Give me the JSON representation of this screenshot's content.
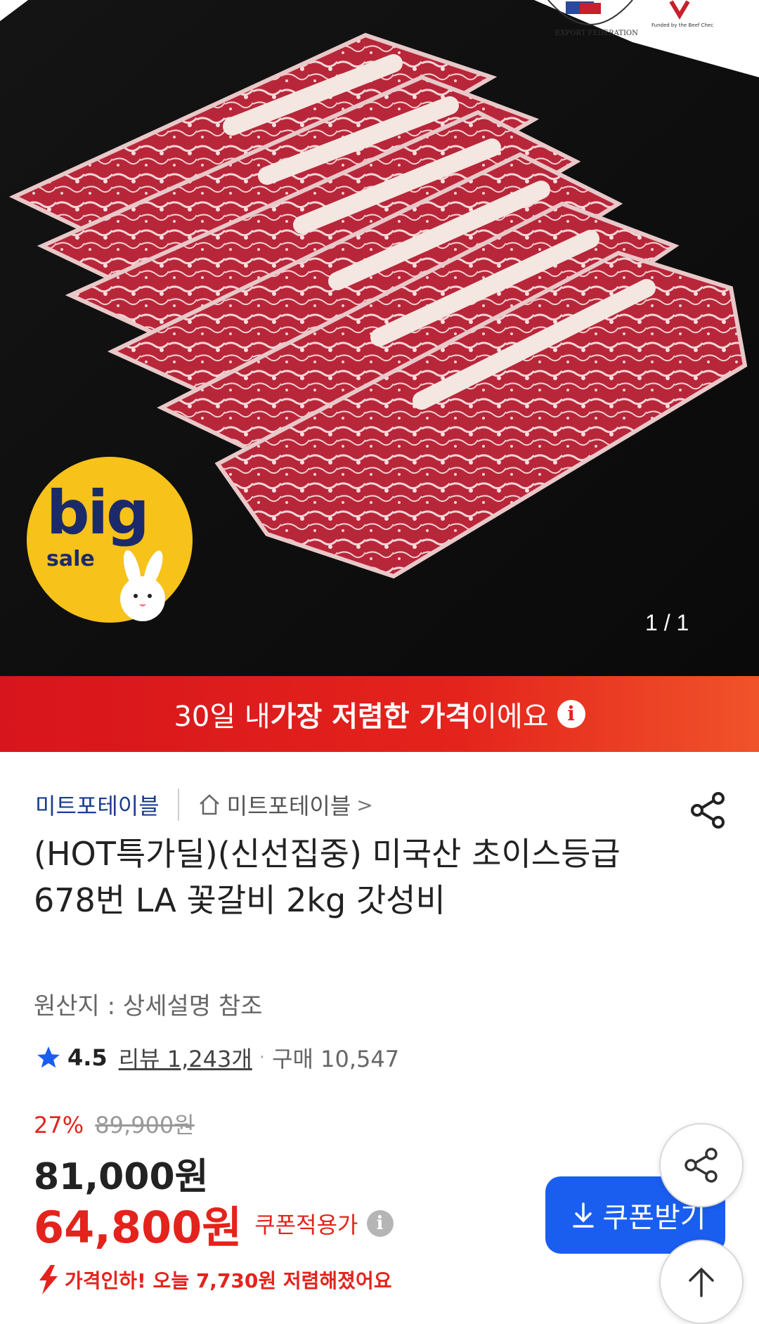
{
  "hero": {
    "counter": "1 / 1",
    "badge_big": "big",
    "badge_sale": "sale",
    "logo_text": "EXPORT FEDERATION",
    "logo_small_text": "Funded by the Beef Checkoff"
  },
  "banner": {
    "pre": "30일 내 ",
    "strong": "가장 저렴한 가격",
    "post": "이에요",
    "info_icon": "i"
  },
  "seller": {
    "name": "미트포테이블",
    "store": "미트포테이블",
    "chevron": ">"
  },
  "product": {
    "title": "(HOT특가딜)(신선집중) 미국산 초이스등급 678번 LA 꽃갈비 2kg 갓성비",
    "origin": "원산지 : 상세설명 참조"
  },
  "rating": {
    "score": "4.5",
    "review": "리뷰 1,243개",
    "dot": "·",
    "purchases": "구매 10,547"
  },
  "price": {
    "discount": "27%",
    "original": "89,900원",
    "sale": "81,000원",
    "coupon_price": "64,800원",
    "coupon_label": "쿠폰적용가",
    "info_icon": "i",
    "drop_note": "가격인하! 오늘 7,730원 저렴해졌어요"
  },
  "coupon_button": {
    "label": "쿠폰받기"
  },
  "icons": {
    "home": "home-icon",
    "share": "share-icon",
    "star": "star-icon",
    "download": "download-icon",
    "arrow_up": "arrow-up-icon",
    "price_drop": "price-drop-icon"
  },
  "colors": {
    "accent_red": "#e4231c",
    "coupon_blue": "#1a5ef0",
    "seller_blue": "#1a3d8f",
    "badge_yellow": "#f7c21a"
  }
}
